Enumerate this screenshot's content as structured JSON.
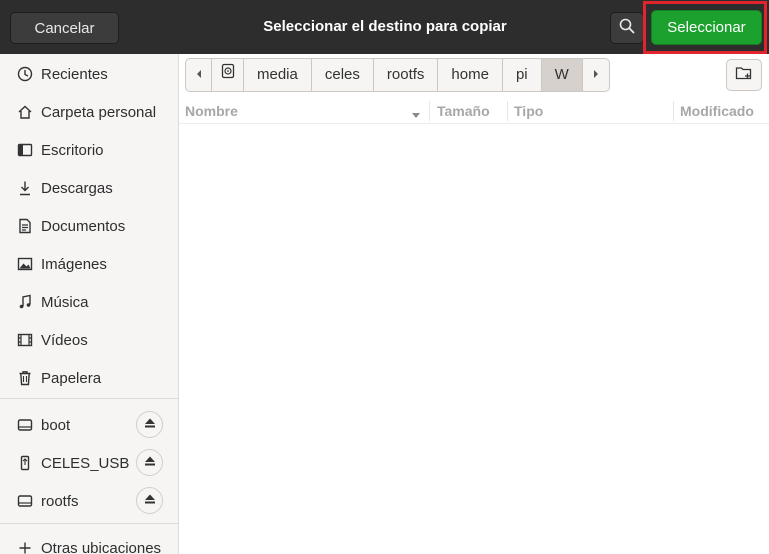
{
  "header": {
    "title": "Seleccionar el destino para copiar",
    "cancel_label": "Cancelar",
    "select_label": "Seleccionar",
    "search_icon": "search-icon"
  },
  "sidebar": {
    "places": [
      {
        "label": "Recientes",
        "icon": "clock-icon"
      },
      {
        "label": "Carpeta personal",
        "icon": "home-icon"
      },
      {
        "label": "Escritorio",
        "icon": "desktop-icon"
      },
      {
        "label": "Descargas",
        "icon": "download-icon"
      },
      {
        "label": "Documentos",
        "icon": "document-icon"
      },
      {
        "label": "Imágenes",
        "icon": "image-icon"
      },
      {
        "label": "Música",
        "icon": "music-icon"
      },
      {
        "label": "Vídeos",
        "icon": "video-icon"
      },
      {
        "label": "Papelera",
        "icon": "trash-icon"
      }
    ],
    "devices": [
      {
        "label": "boot",
        "icon": "drive-icon"
      },
      {
        "label": "CELES_USB",
        "icon": "usb-icon"
      },
      {
        "label": "rootfs",
        "icon": "drive-icon"
      }
    ],
    "other_locations": "Otras ubicaciones"
  },
  "pathbar": {
    "crumbs": [
      "media",
      "celes",
      "rootfs",
      "home",
      "pi",
      "W"
    ]
  },
  "columns": {
    "name": "Nombre",
    "size": "Tamaño",
    "type": "Tipo",
    "modified": "Modificado"
  },
  "colors": {
    "accent_green": "#1ca12e",
    "highlight_red": "#e0252c",
    "headerbar": "#2d2d2d"
  }
}
